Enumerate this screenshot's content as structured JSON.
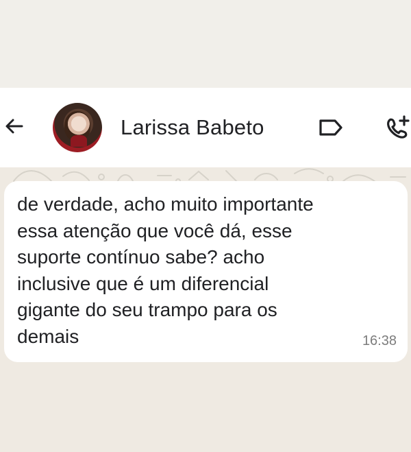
{
  "header": {
    "contact_name": "Larissa Babeto"
  },
  "message": {
    "text": "de verdade, acho muito importante\nessa atenção que você dá, esse\nsuporte contínuo sabe? acho\ninclusive que é um diferencial\ngigante do seu trampo para os\ndemais",
    "time": "16:38"
  },
  "icons": {
    "back": "arrow-left-icon",
    "label": "label-icon",
    "call": "add-call-icon"
  },
  "colors": {
    "background": "#f1efea",
    "header": "#ffffff",
    "bubble": "#ffffff",
    "text": "#202124",
    "time": "#7c7c7c"
  }
}
